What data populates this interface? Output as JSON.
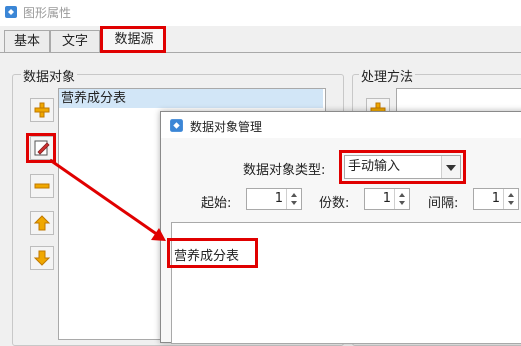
{
  "window": {
    "title": "图形属性"
  },
  "tabs": [
    {
      "label": "基本"
    },
    {
      "label": "文字"
    },
    {
      "label": "数据源"
    }
  ],
  "data_objects_panel": {
    "label": "数据对象",
    "items": [
      "营养成分表"
    ]
  },
  "processing_panel": {
    "label": "处理方法"
  },
  "dialog": {
    "title": "数据对象管理",
    "type_label": "数据对象类型:",
    "type_value": "手动输入",
    "start_label": "起始:",
    "start_value": "1",
    "copies_label": "份数:",
    "copies_value": "1",
    "interval_label": "间隔:",
    "interval_value": "1",
    "content": "营养成分表"
  },
  "colors": {
    "highlight": "#e00000",
    "selection": "#d2e6f7"
  }
}
